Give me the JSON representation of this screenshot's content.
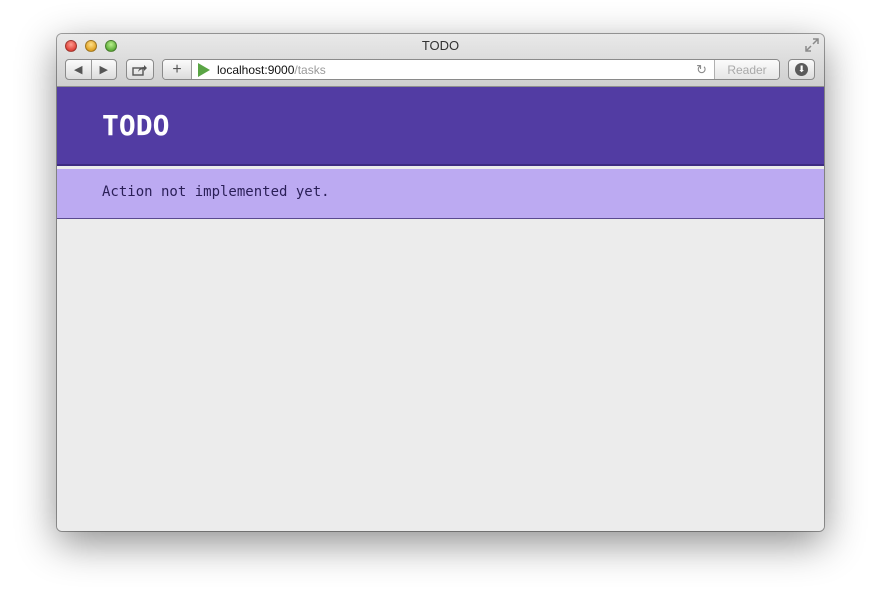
{
  "window": {
    "title": "TODO"
  },
  "toolbar": {
    "back_glyph": "◀",
    "forward_glyph": "▶",
    "new_tab_glyph": "+",
    "reload_glyph": "↻",
    "download_glyph": "⬇",
    "reader_label": "Reader",
    "icons": [
      "back-icon",
      "forward-icon",
      "share-icon",
      "plus-icon",
      "play-icon",
      "reload-icon",
      "download-icon",
      "fullscreen-icon"
    ]
  },
  "address": {
    "host": "localhost:9000",
    "path": "/tasks"
  },
  "app": {
    "title": "TODO",
    "flash_message": "Action not implemented yet."
  },
  "colors": {
    "header_bg": "#523ca3",
    "flash_bg": "#bcaaf2",
    "page_bg": "#ececec",
    "play_icon": "#5aa545"
  }
}
